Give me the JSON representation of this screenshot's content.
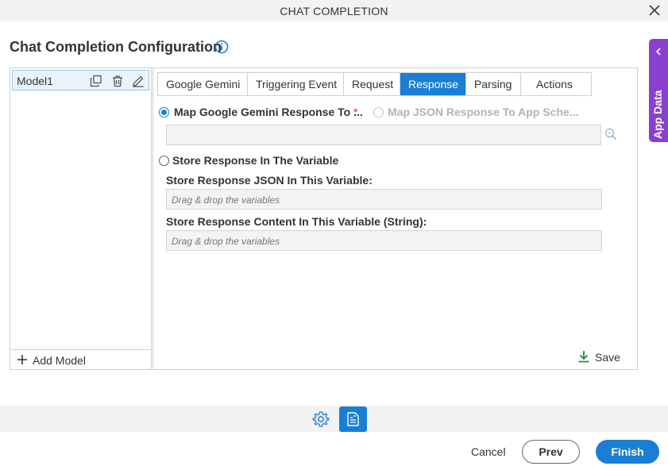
{
  "window": {
    "title": "CHAT COMPLETION"
  },
  "page": {
    "title": "Chat Completion Configuration"
  },
  "app_data_tab": {
    "label": "App Data"
  },
  "models": {
    "items": [
      {
        "label": "Model1"
      }
    ],
    "add_label": "Add Model"
  },
  "tabs": [
    {
      "label": "Google Gemini",
      "active": false
    },
    {
      "label": "Triggering Event",
      "active": false
    },
    {
      "label": "Request",
      "active": false
    },
    {
      "label": "Response",
      "active": true
    },
    {
      "label": "Parsing",
      "active": false
    },
    {
      "label": "Actions",
      "active": false
    }
  ],
  "response": {
    "option_map_gemini": {
      "label": "Map Google Gemini Response To ...",
      "checked": true,
      "required_mark": "*"
    },
    "option_map_json": {
      "label": "Map JSON Response To App Sche...",
      "checked": false,
      "disabled": true
    },
    "map_field_value": "",
    "option_store_variable": {
      "label": "Store Response In The Variable",
      "checked": false
    },
    "store_json": {
      "label": "Store Response JSON In This Variable:",
      "placeholder": "Drag & drop the variables"
    },
    "store_content": {
      "label": "Store Response Content In This Variable (String):",
      "placeholder": "Drag & drop the variables"
    },
    "save_label": "Save"
  },
  "footer": {
    "cancel_label": "Cancel",
    "prev_label": "Prev",
    "finish_label": "Finish"
  },
  "icons": {
    "close": "close-icon",
    "info": "info-icon",
    "chevron": "chevron-left-icon",
    "duplicate": "duplicate-icon",
    "delete": "trash-icon",
    "edit": "pencil-icon",
    "add": "plus-icon",
    "search": "search-icon",
    "save": "download-icon",
    "settings": "gear-icon",
    "document": "document-icon"
  },
  "colors": {
    "accent": "#1a7fd4",
    "app_data": "#8a3fd1",
    "required": "#d9242b",
    "save_icon": "#2e8540"
  }
}
